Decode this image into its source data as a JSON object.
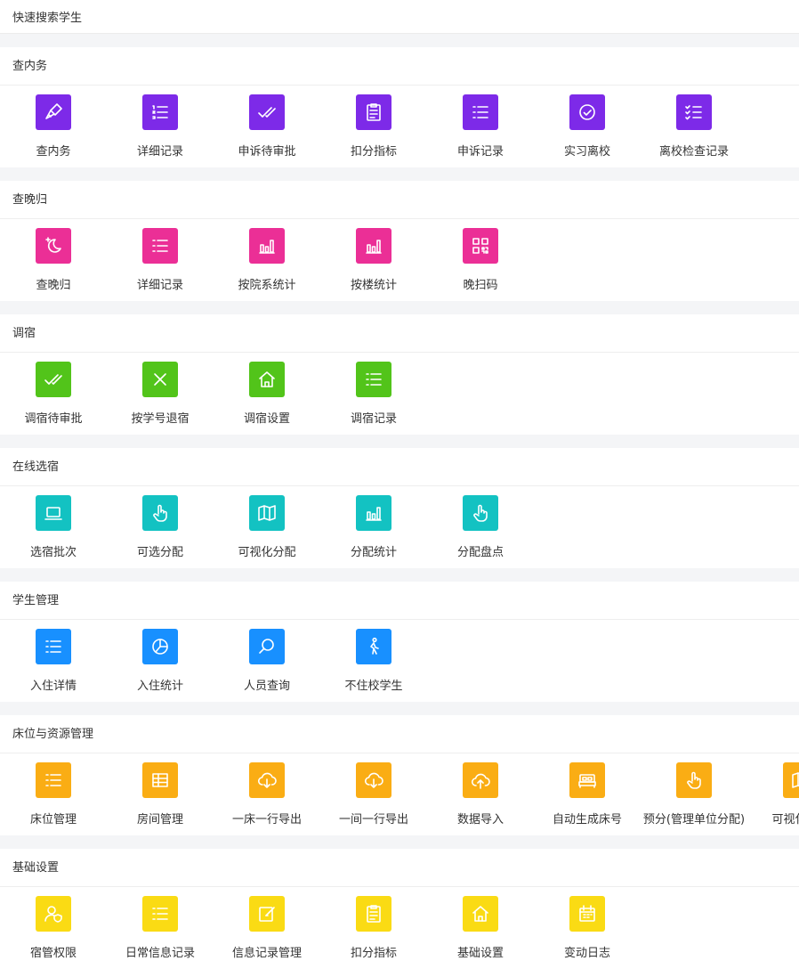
{
  "search": {
    "label": "快速搜索学生"
  },
  "sections": [
    {
      "title": "查内务",
      "color": "#7d2ae8",
      "items": [
        {
          "label": "查内务",
          "icon": "broom-icon"
        },
        {
          "label": "详细记录",
          "icon": "ordered-list-icon"
        },
        {
          "label": "申诉待审批",
          "icon": "double-check-icon"
        },
        {
          "label": "扣分指标",
          "icon": "clipboard-icon"
        },
        {
          "label": "申诉记录",
          "icon": "list-icon"
        },
        {
          "label": "实习离校",
          "icon": "check-circle-icon"
        },
        {
          "label": "离校检查记录",
          "icon": "checklist-icon"
        }
      ]
    },
    {
      "title": "查晚归",
      "color": "#eb2f96",
      "items": [
        {
          "label": "查晚归",
          "icon": "moon-icon"
        },
        {
          "label": "详细记录",
          "icon": "list-icon"
        },
        {
          "label": "按院系统计",
          "icon": "bar-chart-icon"
        },
        {
          "label": "按楼统计",
          "icon": "bar-chart-icon"
        },
        {
          "label": "晚扫码",
          "icon": "qrcode-icon"
        }
      ]
    },
    {
      "title": "调宿",
      "color": "#52c41a",
      "items": [
        {
          "label": "调宿待审批",
          "icon": "double-check-icon"
        },
        {
          "label": "按学号退宿",
          "icon": "close-icon"
        },
        {
          "label": "调宿设置",
          "icon": "home-icon"
        },
        {
          "label": "调宿记录",
          "icon": "list-icon"
        }
      ]
    },
    {
      "title": "在线选宿",
      "color": "#13c2c2",
      "items": [
        {
          "label": "选宿批次",
          "icon": "laptop-icon"
        },
        {
          "label": "可选分配",
          "icon": "pointer-hand-icon"
        },
        {
          "label": "可视化分配",
          "icon": "map-icon"
        },
        {
          "label": "分配统计",
          "icon": "bar-chart-icon"
        },
        {
          "label": "分配盘点",
          "icon": "pointer-hand-icon"
        }
      ]
    },
    {
      "title": "学生管理",
      "color": "#1890ff",
      "items": [
        {
          "label": "入住详情",
          "icon": "list-icon"
        },
        {
          "label": "入住统计",
          "icon": "pie-chart-icon"
        },
        {
          "label": "人员查询",
          "icon": "search-icon"
        },
        {
          "label": "不住校学生",
          "icon": "walking-person-icon"
        }
      ]
    },
    {
      "title": "床位与资源管理",
      "color": "#faad14",
      "items": [
        {
          "label": "床位管理",
          "icon": "list-icon"
        },
        {
          "label": "房间管理",
          "icon": "table-icon"
        },
        {
          "label": "一床一行导出",
          "icon": "cloud-download-icon"
        },
        {
          "label": "一间一行导出",
          "icon": "cloud-download-icon"
        },
        {
          "label": "数据导入",
          "icon": "cloud-upload-icon"
        },
        {
          "label": "自动生成床号",
          "icon": "bed-icon"
        },
        {
          "label": "预分(管理单位分配)",
          "icon": "pointer-hand-icon"
        },
        {
          "label": "可视化分配",
          "icon": "map-icon"
        }
      ]
    },
    {
      "title": "基础设置",
      "color": "#fadb14",
      "items": [
        {
          "label": "宿管权限",
          "icon": "user-shield-icon"
        },
        {
          "label": "日常信息记录",
          "icon": "list-icon"
        },
        {
          "label": "信息记录管理",
          "icon": "edit-icon"
        },
        {
          "label": "扣分指标",
          "icon": "clipboard-icon"
        },
        {
          "label": "基础设置",
          "icon": "home-icon"
        },
        {
          "label": "变动日志",
          "icon": "calendar-icon"
        }
      ]
    }
  ]
}
